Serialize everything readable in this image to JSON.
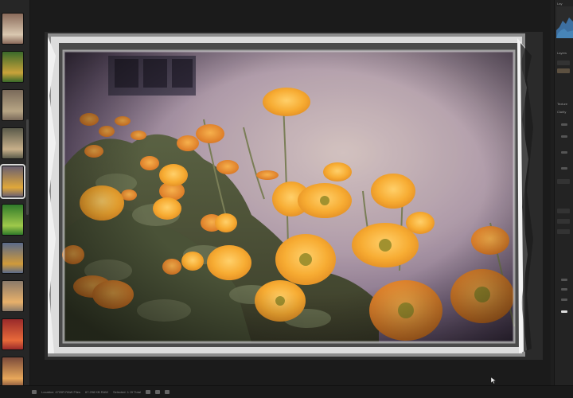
{
  "filmstrip": {
    "thumbs": [
      {
        "colors": [
          "#8a6a5a",
          "#d9c8b0"
        ]
      },
      {
        "colors": [
          "#3a6a2a",
          "#c9a23a"
        ]
      },
      {
        "colors": [
          "#7a6a5a",
          "#b7a584"
        ]
      },
      {
        "colors": [
          "#5a5a4a",
          "#c8b08a"
        ]
      },
      {
        "colors": [
          "#6a6070",
          "#e0a83a"
        ]
      },
      {
        "colors": [
          "#2f7a2a",
          "#9fc84a"
        ]
      },
      {
        "colors": [
          "#5a6a8a",
          "#d09a3a"
        ]
      },
      {
        "colors": [
          "#8a7a6a",
          "#e8b06a"
        ]
      },
      {
        "colors": [
          "#9a2a2a",
          "#e86a3a"
        ]
      },
      {
        "colors": [
          "#7a4a3a",
          "#e8a85a"
        ]
      }
    ],
    "selected_index": 4
  },
  "right_panel": {
    "labels": [
      "Layers",
      "Develop",
      "Clarity"
    ],
    "tab_a": "Lay",
    "tab_b": "Texture",
    "tab_c": "Clarity"
  },
  "statusbar": {
    "location": "Location: 4720R RAW Files",
    "size": "67.298 KB RAW",
    "selection": "Selected: 1 Of Total"
  },
  "colors": {
    "accent": "#f5a623",
    "background": "#1e1e1e",
    "panel": "#232323"
  }
}
